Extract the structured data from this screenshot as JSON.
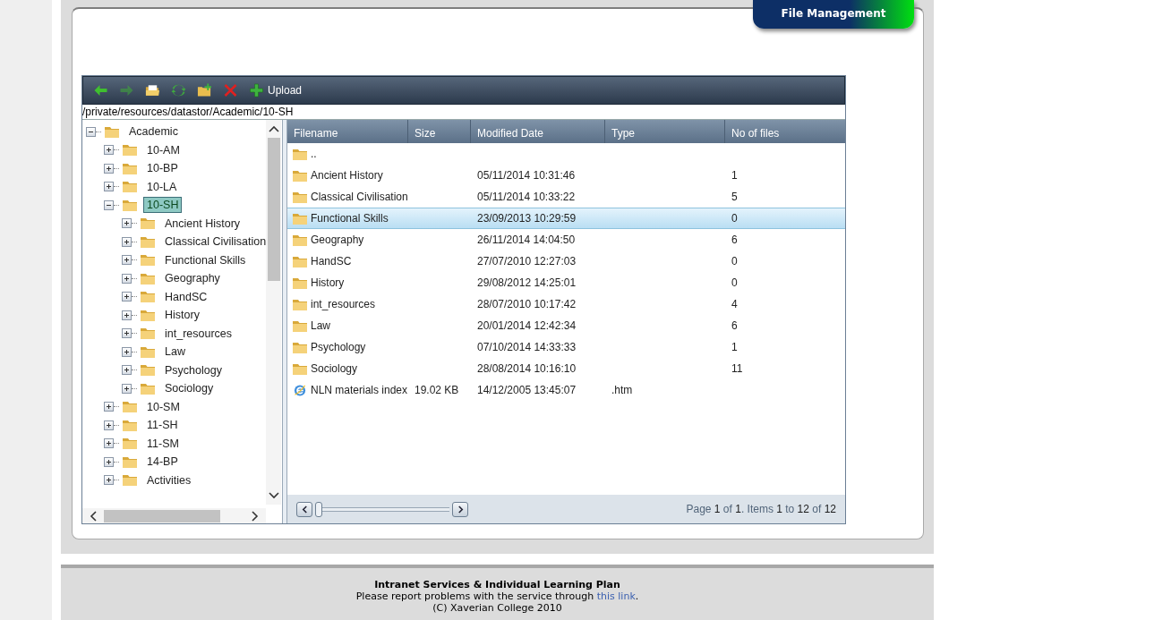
{
  "tab": {
    "label": "File Management"
  },
  "toolbar": {
    "buttons": [
      {
        "kind": "back",
        "disabled": false
      },
      {
        "kind": "forward",
        "disabled": true
      },
      {
        "kind": "open",
        "disabled": false
      },
      {
        "kind": "refresh",
        "disabled": false
      },
      {
        "kind": "new-folder",
        "disabled": false
      },
      {
        "kind": "delete",
        "disabled": false
      },
      {
        "kind": "upload",
        "disabled": false,
        "label": "Upload"
      }
    ]
  },
  "path": {
    "value": "/private/resources/datastor/Academic/10-SH"
  },
  "tree": [
    {
      "label": "Academic",
      "expanded": true,
      "selected": false,
      "children": [
        {
          "label": "10-AM",
          "expanded": false,
          "selected": false
        },
        {
          "label": "10-BP",
          "expanded": false,
          "selected": false
        },
        {
          "label": "10-LA",
          "expanded": false,
          "selected": false
        },
        {
          "label": "10-SH",
          "expanded": true,
          "selected": true,
          "children": [
            {
              "label": "Ancient History",
              "expanded": false,
              "selected": false
            },
            {
              "label": "Classical Civilisation",
              "expanded": false,
              "selected": false
            },
            {
              "label": "Functional Skills",
              "expanded": false,
              "selected": false
            },
            {
              "label": "Geography",
              "expanded": false,
              "selected": false
            },
            {
              "label": "HandSC",
              "expanded": false,
              "selected": false
            },
            {
              "label": "History",
              "expanded": false,
              "selected": false
            },
            {
              "label": "int_resources",
              "expanded": false,
              "selected": false
            },
            {
              "label": "Law",
              "expanded": false,
              "selected": false
            },
            {
              "label": "Psychology",
              "expanded": false,
              "selected": false
            },
            {
              "label": "Sociology",
              "expanded": false,
              "selected": false
            }
          ]
        },
        {
          "label": "10-SM",
          "expanded": false,
          "selected": false
        },
        {
          "label": "11-SH",
          "expanded": false,
          "selected": false
        },
        {
          "label": "11-SM",
          "expanded": false,
          "selected": false
        },
        {
          "label": "14-BP",
          "expanded": false,
          "selected": false
        },
        {
          "label": "Activities",
          "expanded": false,
          "selected": false
        }
      ]
    }
  ],
  "table": {
    "columns": [
      "Filename",
      "Size",
      "Modified Date",
      "Type",
      "No of files"
    ],
    "rows": [
      {
        "kind": "folder",
        "selected": false,
        "cells": [
          "..",
          "",
          "",
          "",
          ""
        ]
      },
      {
        "kind": "folder",
        "selected": false,
        "cells": [
          "Ancient History",
          "",
          "05/11/2014 10:31:46",
          "",
          "1"
        ]
      },
      {
        "kind": "folder",
        "selected": false,
        "cells": [
          "Classical Civilisation",
          "",
          "05/11/2014 10:33:22",
          "",
          "5"
        ]
      },
      {
        "kind": "folder",
        "selected": true,
        "cells": [
          "Functional Skills",
          "",
          "23/09/2013 10:29:59",
          "",
          "0"
        ]
      },
      {
        "kind": "folder",
        "selected": false,
        "cells": [
          "Geography",
          "",
          "26/11/2014 14:04:50",
          "",
          "6"
        ]
      },
      {
        "kind": "folder",
        "selected": false,
        "cells": [
          "HandSC",
          "",
          "27/07/2010 12:27:03",
          "",
          "0"
        ]
      },
      {
        "kind": "folder",
        "selected": false,
        "cells": [
          "History",
          "",
          "29/08/2012 14:25:01",
          "",
          "0"
        ]
      },
      {
        "kind": "folder",
        "selected": false,
        "cells": [
          "int_resources",
          "",
          "28/07/2010 10:17:42",
          "",
          "4"
        ]
      },
      {
        "kind": "folder",
        "selected": false,
        "cells": [
          "Law",
          "",
          "20/01/2014 12:42:34",
          "",
          "6"
        ]
      },
      {
        "kind": "folder",
        "selected": false,
        "cells": [
          "Psychology",
          "",
          "07/10/2014 14:33:33",
          "",
          "1"
        ]
      },
      {
        "kind": "folder",
        "selected": false,
        "cells": [
          "Sociology",
          "",
          "28/08/2014 10:16:10",
          "",
          "11"
        ]
      },
      {
        "kind": "web-page",
        "selected": false,
        "cells": [
          "NLN materials index",
          "19.02 KB",
          "14/12/2005 13:45:07",
          ".htm",
          ""
        ]
      }
    ]
  },
  "pager": {
    "level": 0,
    "summary": "Page **1** of **1**. Items **1** to **12** of **12**"
  },
  "footer": {
    "title": "Intranet Services & Individual Learning Plan",
    "notice": "Please report problems with the service through ",
    "link": "this link",
    "notice_end": ".",
    "copyright": "(C) Xaverian College 2010"
  }
}
